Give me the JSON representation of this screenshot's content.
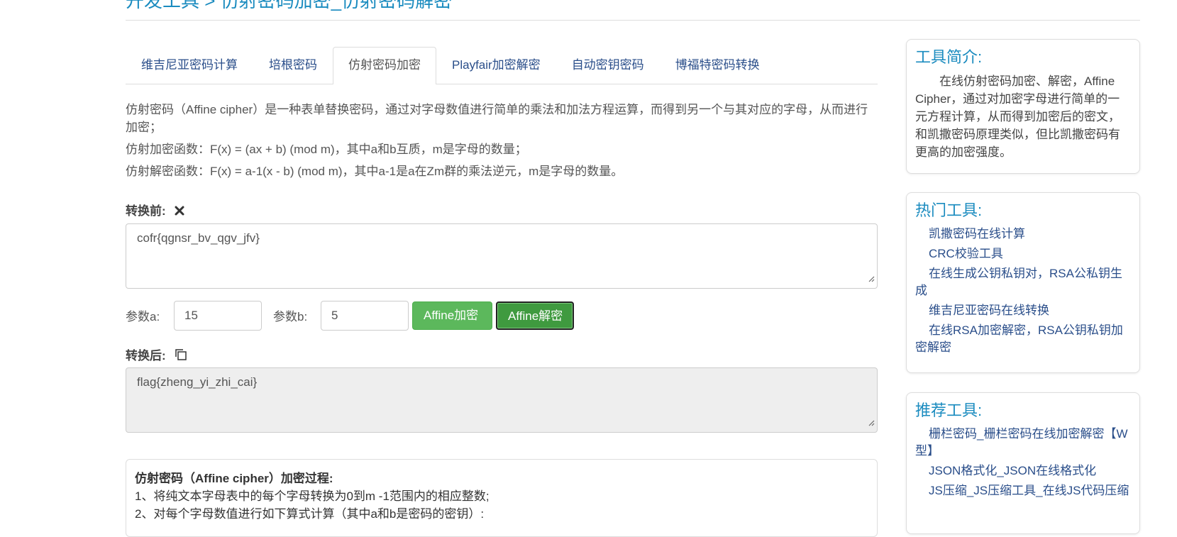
{
  "header": {
    "title": "开发工具 > 仿射密码加密_仿射密码解密"
  },
  "tabs": [
    {
      "label": "维吉尼亚密码计算"
    },
    {
      "label": "培根密码"
    },
    {
      "label": "仿射密码加密"
    },
    {
      "label": "Playfair加密解密"
    },
    {
      "label": "自动密钥密码"
    },
    {
      "label": "博福特密码转换"
    }
  ],
  "description": {
    "line1": "仿射密码（Affine cipher）是一种表单替换密码，通过对字母数值进行简单的乘法和加法方程运算，而得到另一个与其对应的字母，从而进行加密；",
    "line2": "仿射加密函数：F(x) = (ax + b) (mod m)，其中a和b互质，m是字母的数量；",
    "line3": "仿射解密函数：F(x) = a-1(x - b) (mod m)，其中a-1是a在Zm群的乘法逆元，m是字母的数量。"
  },
  "input": {
    "label": "转换前:",
    "value": "cofr{qgnsr_bv_qgv_jfv}"
  },
  "params": {
    "a_label": "参数a:",
    "a_value": "15",
    "b_label": "参数b:",
    "b_value": "5",
    "encrypt_label": "Affine加密",
    "decrypt_label": "Affine解密"
  },
  "output": {
    "label": "转换后:",
    "value": "flag{zheng_yi_zhi_cai}"
  },
  "process": {
    "title": "仿射密码（Affine cipher）加密过程:",
    "step1": "1、将纯文本字母表中的每个字母转换为0到m -1范围内的相应整数;",
    "step2": "2、对每个字母数值进行如下算式计算（其中a和b是密码的密钥）:"
  },
  "sidebar": {
    "intro": {
      "title": "工具简介:",
      "text": "在线仿射密码加密、解密，Affine Cipher，通过对加密字母进行简单的一元方程计算，从而得到加密后的密文，和凯撒密码原理类似，但比凯撒密码有更高的加密强度。"
    },
    "hot": {
      "title": "热门工具:",
      "items": [
        "凯撒密码在线计算",
        "CRC校验工具",
        "在线生成公钥私钥对，RSA公私钥生成",
        "维吉尼亚密码在线转换",
        "在线RSA加密解密，RSA公钥私钥加密解密"
      ]
    },
    "recommend": {
      "title": "推荐工具:",
      "items": [
        "栅栏密码_栅栏密码在线加密解密【W型】",
        "JSON格式化_JSON在线格式化",
        "JS压缩_JS压缩工具_在线JS代码压缩"
      ]
    }
  },
  "colors": {
    "accent": "#1a8bbf",
    "link": "#2a4e8a",
    "success": "#5cb85c"
  }
}
